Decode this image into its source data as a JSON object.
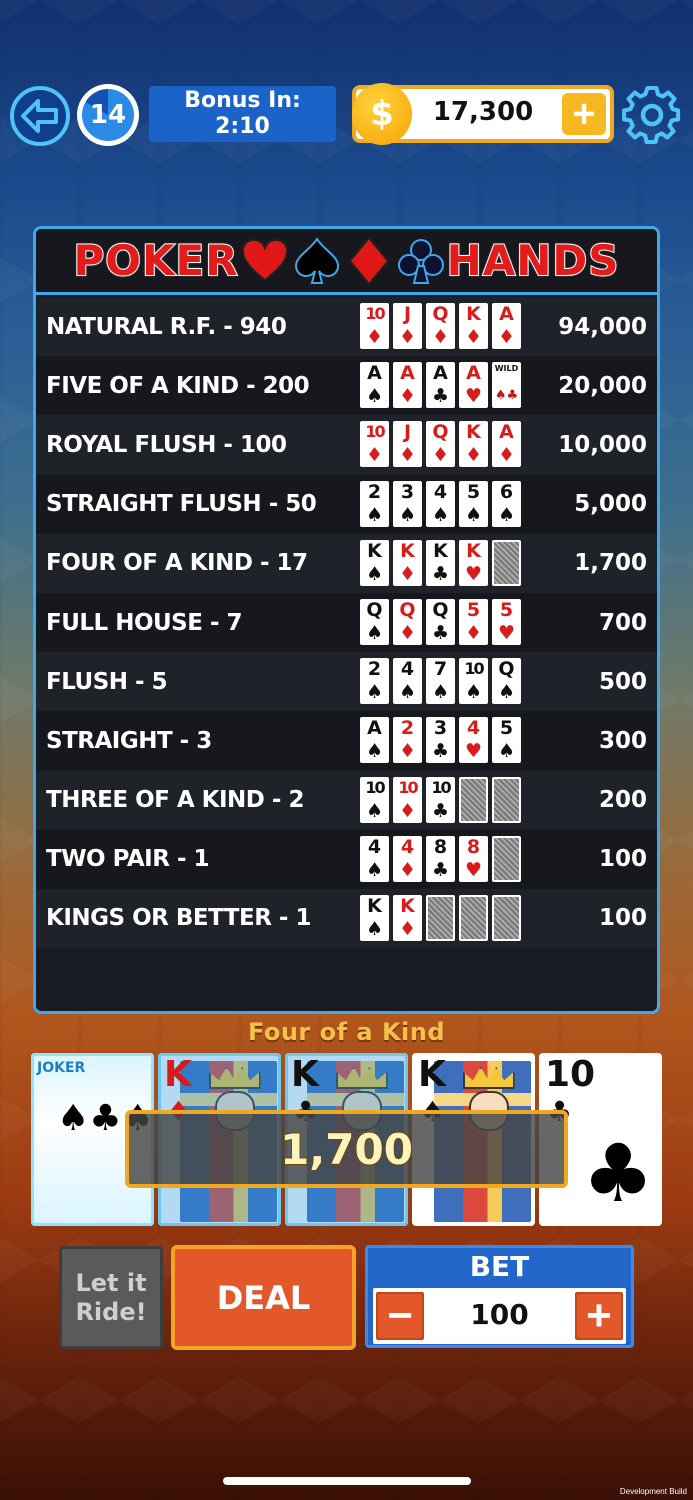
{
  "header": {
    "level": "14",
    "bonus_label": "Bonus In:",
    "bonus_time": "2:10",
    "coin_symbol": "$",
    "coins": "17,300",
    "coin_plus": "+"
  },
  "paytable": {
    "title_left": "POKER",
    "title_right": "HANDS",
    "rows": [
      {
        "name": "NATURAL R.F. - 940",
        "payout": "94,000",
        "cards": [
          [
            "10",
            "♦",
            "red"
          ],
          [
            "J",
            "♦",
            "red"
          ],
          [
            "Q",
            "♦",
            "red"
          ],
          [
            "K",
            "♦",
            "red"
          ],
          [
            "A",
            "♦",
            "red"
          ]
        ]
      },
      {
        "name": "FIVE OF A KIND - 200",
        "payout": "20,000",
        "cards": [
          [
            "A",
            "♠",
            "black"
          ],
          [
            "A",
            "♦",
            "red"
          ],
          [
            "A",
            "♣",
            "black"
          ],
          [
            "A",
            "♥",
            "red"
          ],
          [
            "WILD",
            "♠♣",
            "black"
          ]
        ]
      },
      {
        "name": "ROYAL FLUSH - 100",
        "payout": "10,000",
        "cards": [
          [
            "10",
            "♦",
            "red"
          ],
          [
            "J",
            "♦",
            "red"
          ],
          [
            "Q",
            "♦",
            "red"
          ],
          [
            "K",
            "♦",
            "red"
          ],
          [
            "A",
            "♦",
            "red"
          ]
        ]
      },
      {
        "name": "STRAIGHT FLUSH - 50",
        "payout": "5,000",
        "cards": [
          [
            "2",
            "♠",
            "black"
          ],
          [
            "3",
            "♠",
            "black"
          ],
          [
            "4",
            "♠",
            "black"
          ],
          [
            "5",
            "♠",
            "black"
          ],
          [
            "6",
            "♠",
            "black"
          ]
        ]
      },
      {
        "name": "FOUR OF A KIND - 17",
        "payout": "1,700",
        "cards": [
          [
            "K",
            "♠",
            "black"
          ],
          [
            "K",
            "♦",
            "red"
          ],
          [
            "K",
            "♣",
            "black"
          ],
          [
            "K",
            "♥",
            "red"
          ],
          [
            "",
            "",
            "back"
          ]
        ]
      },
      {
        "name": "FULL HOUSE - 7",
        "payout": "700",
        "cards": [
          [
            "Q",
            "♠",
            "black"
          ],
          [
            "Q",
            "♦",
            "red"
          ],
          [
            "Q",
            "♣",
            "black"
          ],
          [
            "5",
            "♦",
            "red"
          ],
          [
            "5",
            "♥",
            "red"
          ]
        ]
      },
      {
        "name": "FLUSH - 5",
        "payout": "500",
        "cards": [
          [
            "2",
            "♠",
            "black"
          ],
          [
            "4",
            "♠",
            "black"
          ],
          [
            "7",
            "♠",
            "black"
          ],
          [
            "10",
            "♠",
            "black"
          ],
          [
            "Q",
            "♠",
            "black"
          ]
        ]
      },
      {
        "name": "STRAIGHT - 3",
        "payout": "300",
        "cards": [
          [
            "A",
            "♠",
            "black"
          ],
          [
            "2",
            "♦",
            "red"
          ],
          [
            "3",
            "♣",
            "black"
          ],
          [
            "4",
            "♥",
            "red"
          ],
          [
            "5",
            "♠",
            "black"
          ]
        ]
      },
      {
        "name": "THREE OF A KIND - 2",
        "payout": "200",
        "cards": [
          [
            "10",
            "♠",
            "black"
          ],
          [
            "10",
            "♦",
            "red"
          ],
          [
            "10",
            "♣",
            "black"
          ],
          [
            "",
            "",
            "back"
          ],
          [
            "",
            "",
            "back"
          ]
        ]
      },
      {
        "name": "TWO PAIR - 1",
        "payout": "100",
        "cards": [
          [
            "4",
            "♠",
            "black"
          ],
          [
            "4",
            "♦",
            "red"
          ],
          [
            "8",
            "♣",
            "black"
          ],
          [
            "8",
            "♥",
            "red"
          ],
          [
            "",
            "",
            "back"
          ]
        ]
      },
      {
        "name": "KINGS OR BETTER - 1",
        "payout": "100",
        "cards": [
          [
            "K",
            "♠",
            "black"
          ],
          [
            "K",
            "♦",
            "red"
          ],
          [
            "",
            "",
            "back"
          ],
          [
            "",
            "",
            "back"
          ],
          [
            "",
            "",
            "back"
          ]
        ]
      }
    ]
  },
  "result": {
    "hand_name": "Four of a Kind",
    "win_amount": "1,700",
    "cards": [
      {
        "rank": "JOKER",
        "suit": "♠♣♠♦",
        "color": "black",
        "type": "joker"
      },
      {
        "rank": "K",
        "suit": "♦",
        "color": "red",
        "type": "king"
      },
      {
        "rank": "K",
        "suit": "♣",
        "color": "black",
        "type": "king"
      },
      {
        "rank": "K",
        "suit": "♠",
        "color": "black",
        "type": "king"
      },
      {
        "rank": "10",
        "suit": "♣",
        "color": "black",
        "type": "pip"
      }
    ]
  },
  "controls": {
    "let_it_ride": "Let it Ride!",
    "deal": "DEAL",
    "bet_label": "BET",
    "bet_value": "100",
    "minus": "−",
    "plus": "+"
  },
  "footer": {
    "dev_build": "Development Build"
  }
}
